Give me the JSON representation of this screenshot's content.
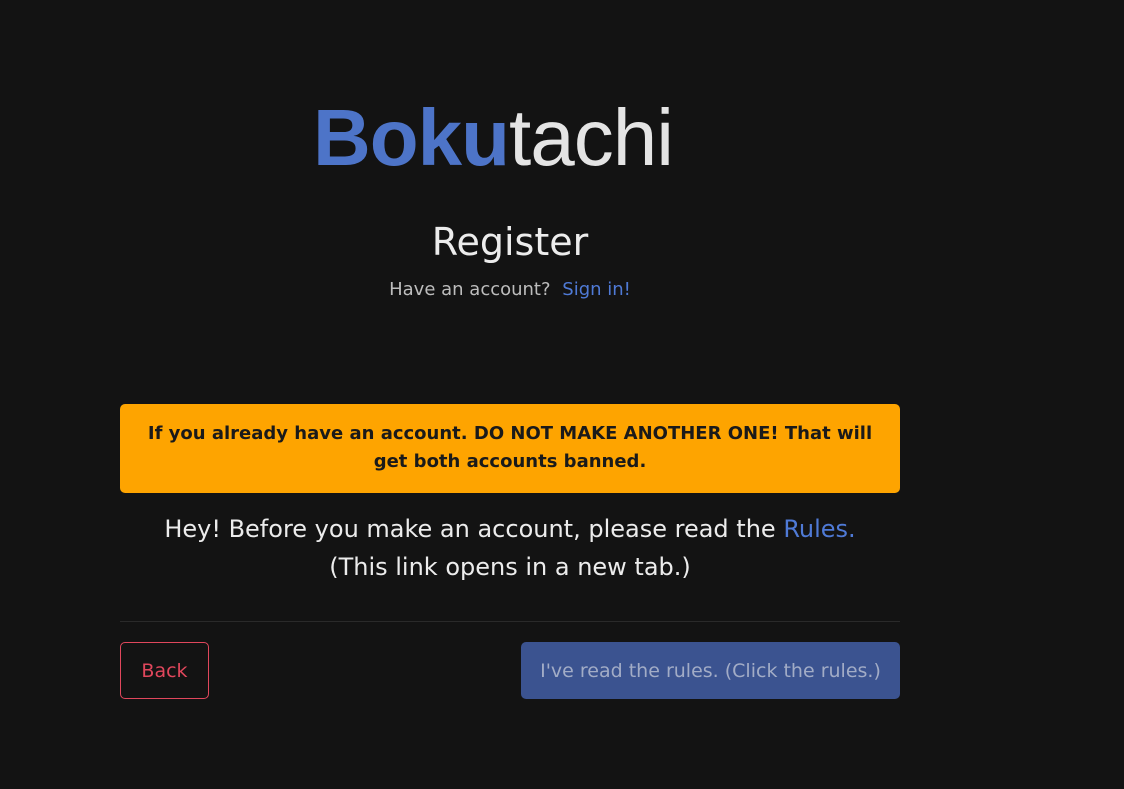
{
  "logo": {
    "part1": "Boku",
    "part2": "tachi"
  },
  "title": "Register",
  "signin": {
    "prompt": "Have an account?",
    "link": "Sign in!"
  },
  "warning": "If you already have an account. DO NOT MAKE ANOTHER ONE! That will get both accounts banned.",
  "rules": {
    "text": "Hey! Before you make an account, please read the ",
    "link": "Rules.",
    "note": "(This link opens in a new tab.)"
  },
  "buttons": {
    "back": "Back",
    "read": "I've read the rules. (Click the rules.)"
  },
  "colors": {
    "background": "#131313",
    "accent": "#4d74c8",
    "warning": "#fea400",
    "danger": "#e0475c",
    "disabled_button": "#3b5390"
  }
}
